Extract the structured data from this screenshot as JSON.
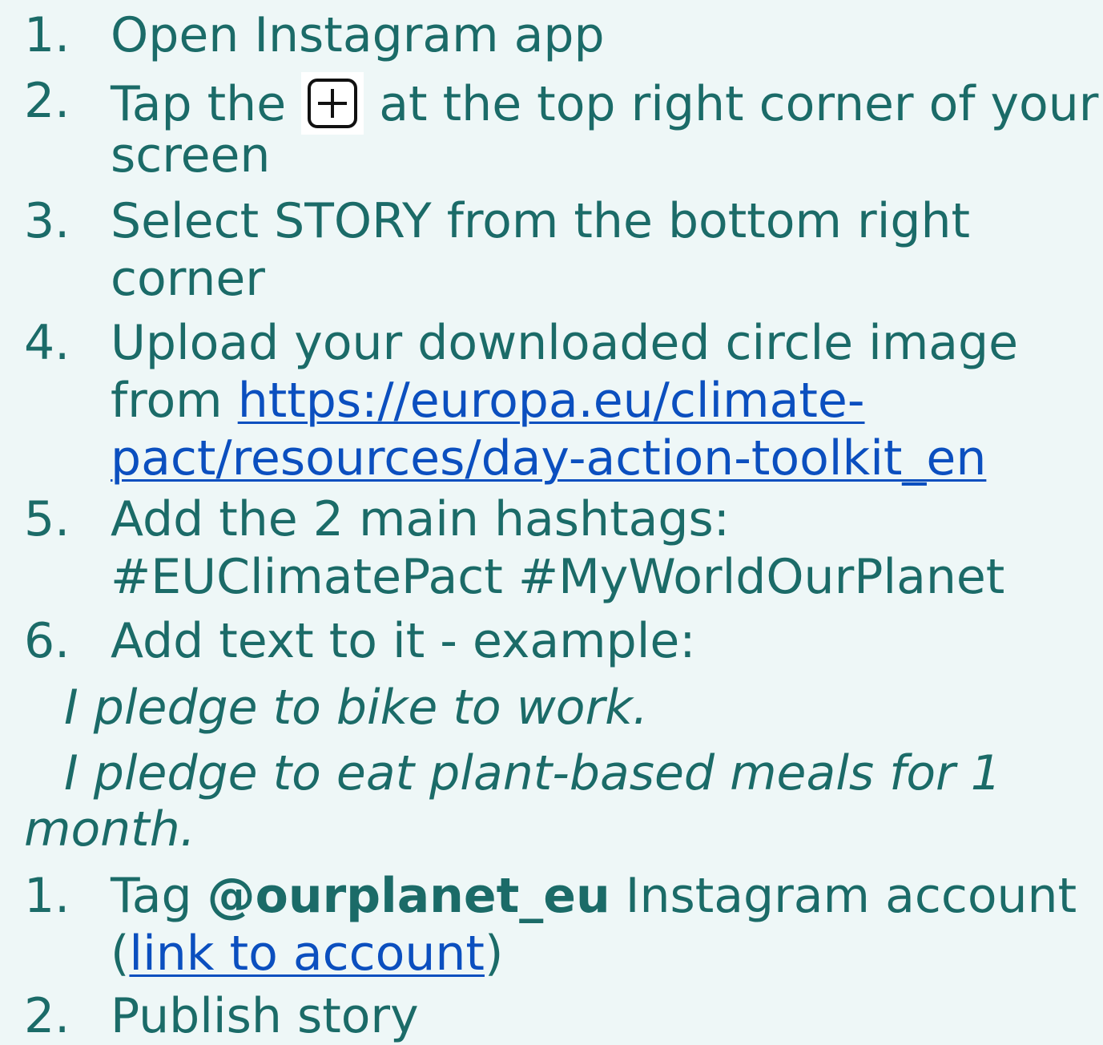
{
  "steps_part1": [
    {
      "num": "1.",
      "text": "Open Instagram app"
    },
    {
      "num": "2.",
      "text_before_icon": "Tap the",
      "icon": "plus-square-icon",
      "text_after_icon": "at the top right corner of your",
      "text_line2": "screen"
    },
    {
      "num": "3.",
      "text": "Select STORY from the bottom right",
      "text_line2": "corner"
    },
    {
      "num": "4.",
      "text": "Upload your downloaded circle image",
      "text_line2_prefix": "from ",
      "link_line2": "https://europa.eu/climate-",
      "link_line3": "pact/resources/day-action-toolkit_en"
    },
    {
      "num": "5.",
      "text": "Add the 2 main hashtags:",
      "text_line2": "#EUClimatePact #MyWorldOurPlanet"
    },
    {
      "num": "6.",
      "text": "Add text to it - example:"
    }
  ],
  "examples": [
    {
      "line1": "I pledge to bike to work."
    },
    {
      "line1": "I pledge to eat plant-based meals for 1",
      "line2": "month."
    }
  ],
  "steps_part2": [
    {
      "num": "1.",
      "prefix": "Tag ",
      "bold": "@ourplanet_eu",
      "suffix": " Instagram account",
      "line2_open": "(",
      "line2_link": "link to account",
      "line2_close": ")"
    },
    {
      "num": "2.",
      "text": "Publish story"
    }
  ],
  "colors": {
    "text": "#1b6b68",
    "link": "#0b4fbf",
    "background": "#eef7f7"
  }
}
